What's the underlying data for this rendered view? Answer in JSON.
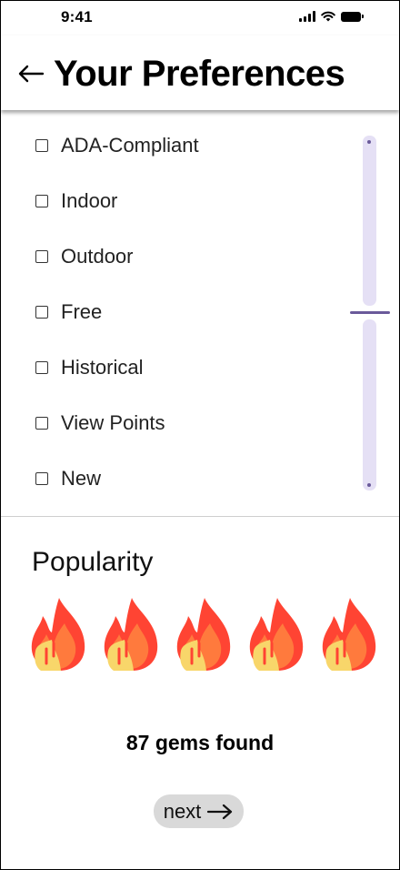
{
  "status_bar": {
    "time": "9:41"
  },
  "header": {
    "title": "Your Preferences",
    "back_icon": "arrow-left-icon"
  },
  "filters": {
    "items": [
      {
        "label": "ADA-Compliant",
        "checked": false
      },
      {
        "label": "Indoor",
        "checked": false
      },
      {
        "label": "Outdoor",
        "checked": false
      },
      {
        "label": "Free",
        "checked": false
      },
      {
        "label": "Historical",
        "checked": false
      },
      {
        "label": "View Points",
        "checked": false
      },
      {
        "label": "New",
        "checked": false
      }
    ]
  },
  "popularity": {
    "title": "Popularity",
    "rating": 5,
    "max": 5,
    "icon": "fire-icon",
    "colors": {
      "outer": "#ff4433",
      "inner": "#f8d66a"
    }
  },
  "results": {
    "text": "87 gems found"
  },
  "next_button": {
    "label": "next",
    "icon": "arrow-right-icon"
  },
  "colors": {
    "scroll_track": "#e5e0f5",
    "scroll_handle": "#6a5a9a",
    "button_bg": "#d9d9d9"
  }
}
